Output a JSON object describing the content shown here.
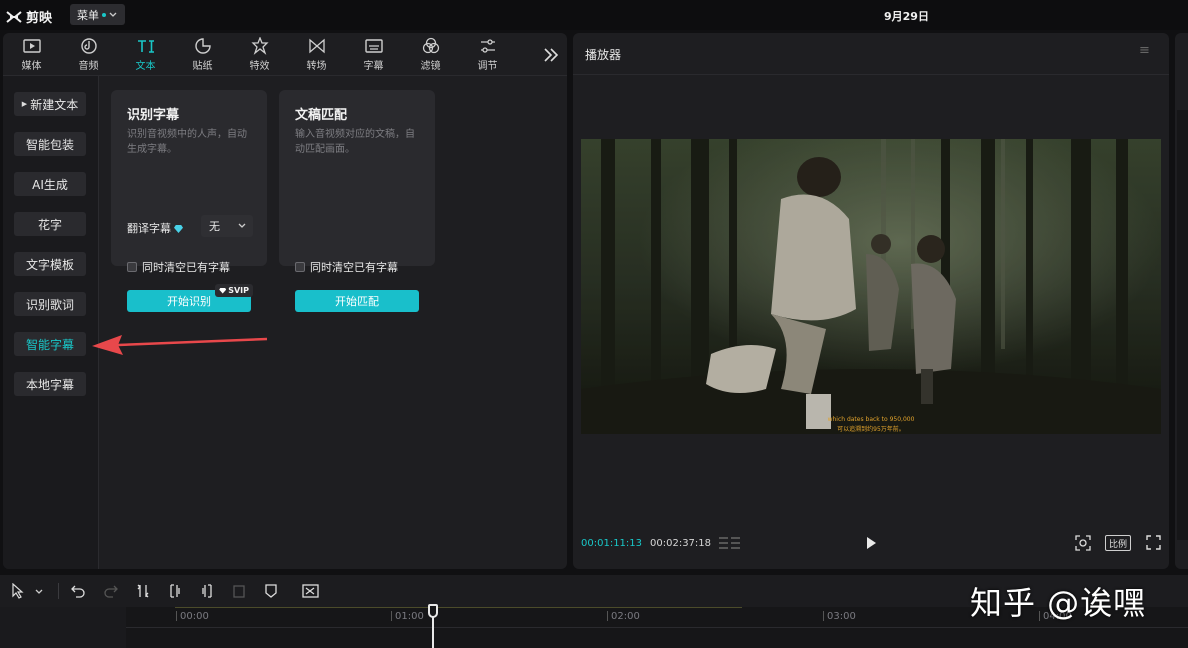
{
  "app": {
    "name": "剪映",
    "menu_label": "菜单"
  },
  "topbar": {
    "date": "9月29日"
  },
  "tool_tabs": [
    {
      "label": "媒体",
      "icon": "media-icon"
    },
    {
      "label": "音频",
      "icon": "audio-icon"
    },
    {
      "label": "文本",
      "icon": "text-icon",
      "active": true
    },
    {
      "label": "贴纸",
      "icon": "sticker-icon"
    },
    {
      "label": "特效",
      "icon": "effects-icon"
    },
    {
      "label": "转场",
      "icon": "transition-icon"
    },
    {
      "label": "字幕",
      "icon": "subtitle-icon"
    },
    {
      "label": "滤镜",
      "icon": "filter-icon"
    },
    {
      "label": "调节",
      "icon": "adjust-icon"
    }
  ],
  "side_nav": [
    {
      "label": "新建文本",
      "has_caret": true
    },
    {
      "label": "智能包装"
    },
    {
      "label": "AI生成"
    },
    {
      "label": "花字"
    },
    {
      "label": "文字模板"
    },
    {
      "label": "识别歌词"
    },
    {
      "label": "智能字幕",
      "active": true
    },
    {
      "label": "本地字幕"
    }
  ],
  "cards": {
    "recognize": {
      "title": "识别字幕",
      "description": "识别音视频中的人声，自动生成字幕。",
      "translate_label": "翻译字幕",
      "translate_value": "无",
      "checkbox_label": "同时清空已有字幕",
      "button_label": "开始识别",
      "badge": "SVIP"
    },
    "match": {
      "title": "文稿匹配",
      "description": "输入音视频对应的文稿，自动匹配画面。",
      "checkbox_label": "同时清空已有字幕",
      "button_label": "开始匹配"
    }
  },
  "player": {
    "title": "播放器",
    "subtitle_en": "which dates back to 950,000",
    "subtitle_zh": "可以追溯到约95万年前。",
    "current_time": "00:01:11:13",
    "total_time": "00:02:37:18",
    "ratio_label": "比例"
  },
  "timeline": {
    "ruler_labels": [
      "00:00",
      "01:00",
      "02:00",
      "03:00",
      "04:00"
    ]
  },
  "watermark": "知乎 @诶嘿",
  "colors": {
    "accent": "#19c7c8",
    "annotation_arrow": "#e8484b"
  }
}
